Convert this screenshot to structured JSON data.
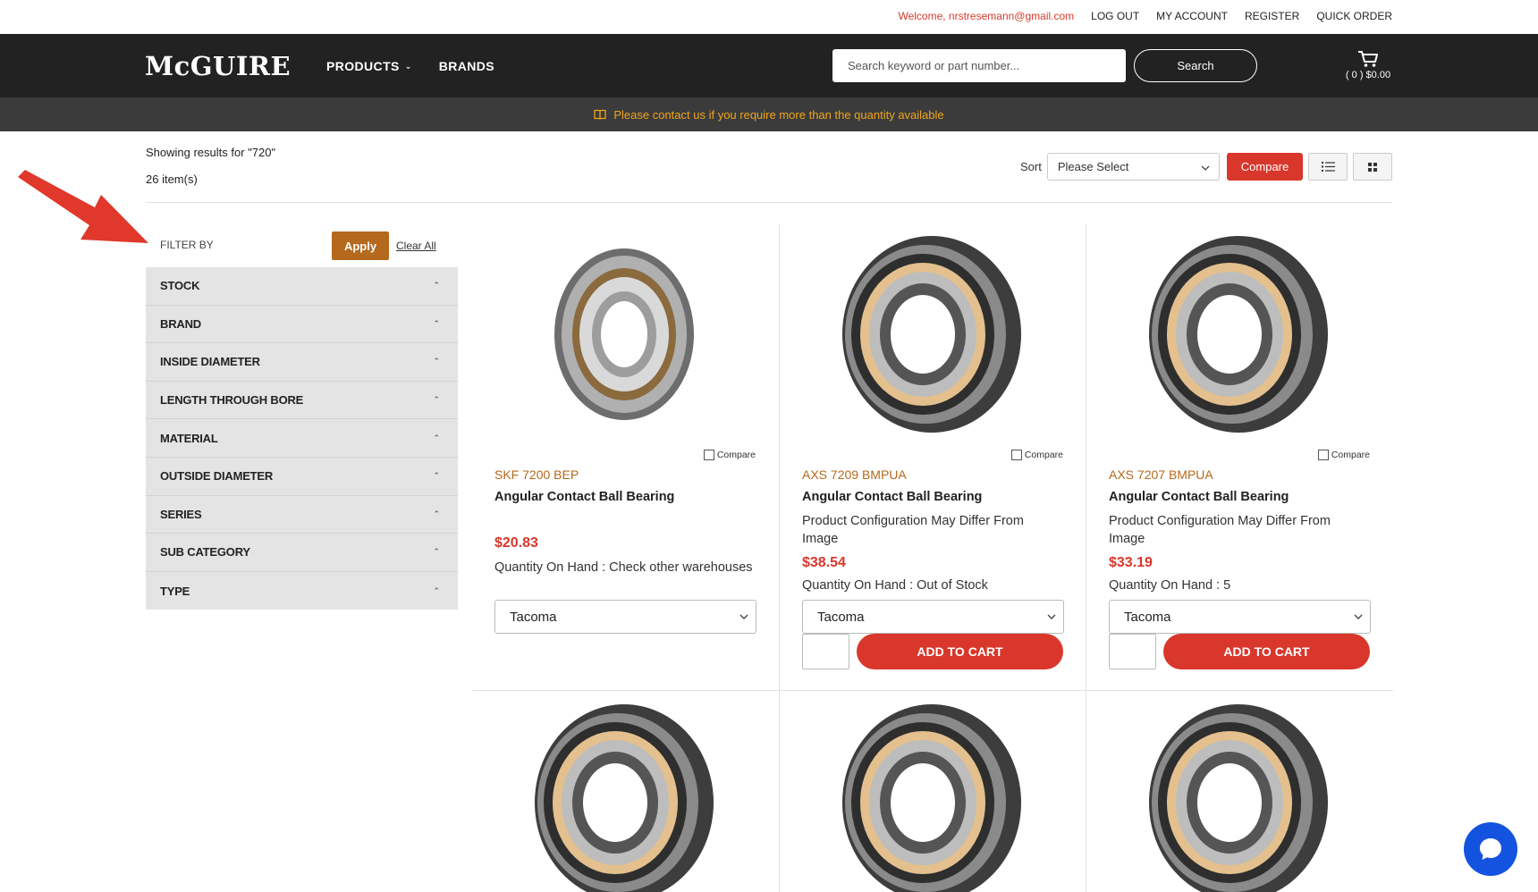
{
  "utility": {
    "welcome": "Welcome, nrstresemann@gmail.com",
    "links": [
      "LOG OUT",
      "MY ACCOUNT",
      "REGISTER",
      "QUICK ORDER"
    ]
  },
  "header": {
    "logo": "McGUIRE",
    "nav": [
      {
        "label": "PRODUCTS",
        "has_dropdown": true
      },
      {
        "label": "BRANDS",
        "has_dropdown": false
      }
    ],
    "search_placeholder": "Search keyword or part number...",
    "search_button": "Search",
    "cart_text": "( 0 ) $0.00"
  },
  "notice": {
    "icon": "book-icon",
    "text": "Please contact us if you require more than the quantity available",
    "color": "#f1a51d"
  },
  "results": {
    "showing": "Showing results for \"720\"",
    "count": "26 item(s)"
  },
  "toolbar": {
    "sort_label": "Sort",
    "sort_value": "Please Select",
    "compare_label": "Compare",
    "view_list_icon": "list-view-icon",
    "view_grid_icon": "grid-view-icon"
  },
  "filters": {
    "label": "FILTER BY",
    "apply": "Apply",
    "clear": "Clear All",
    "facets": [
      "STOCK",
      "BRAND",
      "INSIDE DIAMETER",
      "LENGTH THROUGH BORE",
      "MATERIAL",
      "OUTSIDE DIAMETER",
      "SERIES",
      "SUB CATEGORY",
      "TYPE"
    ]
  },
  "products": [
    {
      "sku": "SKF 7200 BEP",
      "title": "Angular Contact Ball Bearing",
      "desc": "",
      "price": "$20.83",
      "qoh": "Quantity On Hand : Check other warehouses",
      "warehouse": "Tacoma",
      "compare": "Compare",
      "add_to_cart": ""
    },
    {
      "sku": "AXS 7209 BMPUA",
      "title": "Angular Contact Ball Bearing",
      "desc": "Product Configuration May Differ From Image",
      "price": "$38.54",
      "qoh": "Quantity On Hand : Out of Stock",
      "warehouse": "Tacoma",
      "compare": "Compare",
      "add_to_cart": "ADD TO CART"
    },
    {
      "sku": "AXS 7207 BMPUA",
      "title": "Angular Contact Ball Bearing",
      "desc": "Product Configuration May Differ From Image",
      "price": "$33.19",
      "qoh": "Quantity On Hand : 5",
      "warehouse": "Tacoma",
      "compare": "Compare",
      "add_to_cart": "ADD TO CART"
    }
  ],
  "colors": {
    "brand_dark": "#222222",
    "accent_red": "#d9372b",
    "accent_orange": "#b4691c",
    "chat_blue": "#1353e0"
  },
  "chat_icon": "chat-bubble-icon"
}
